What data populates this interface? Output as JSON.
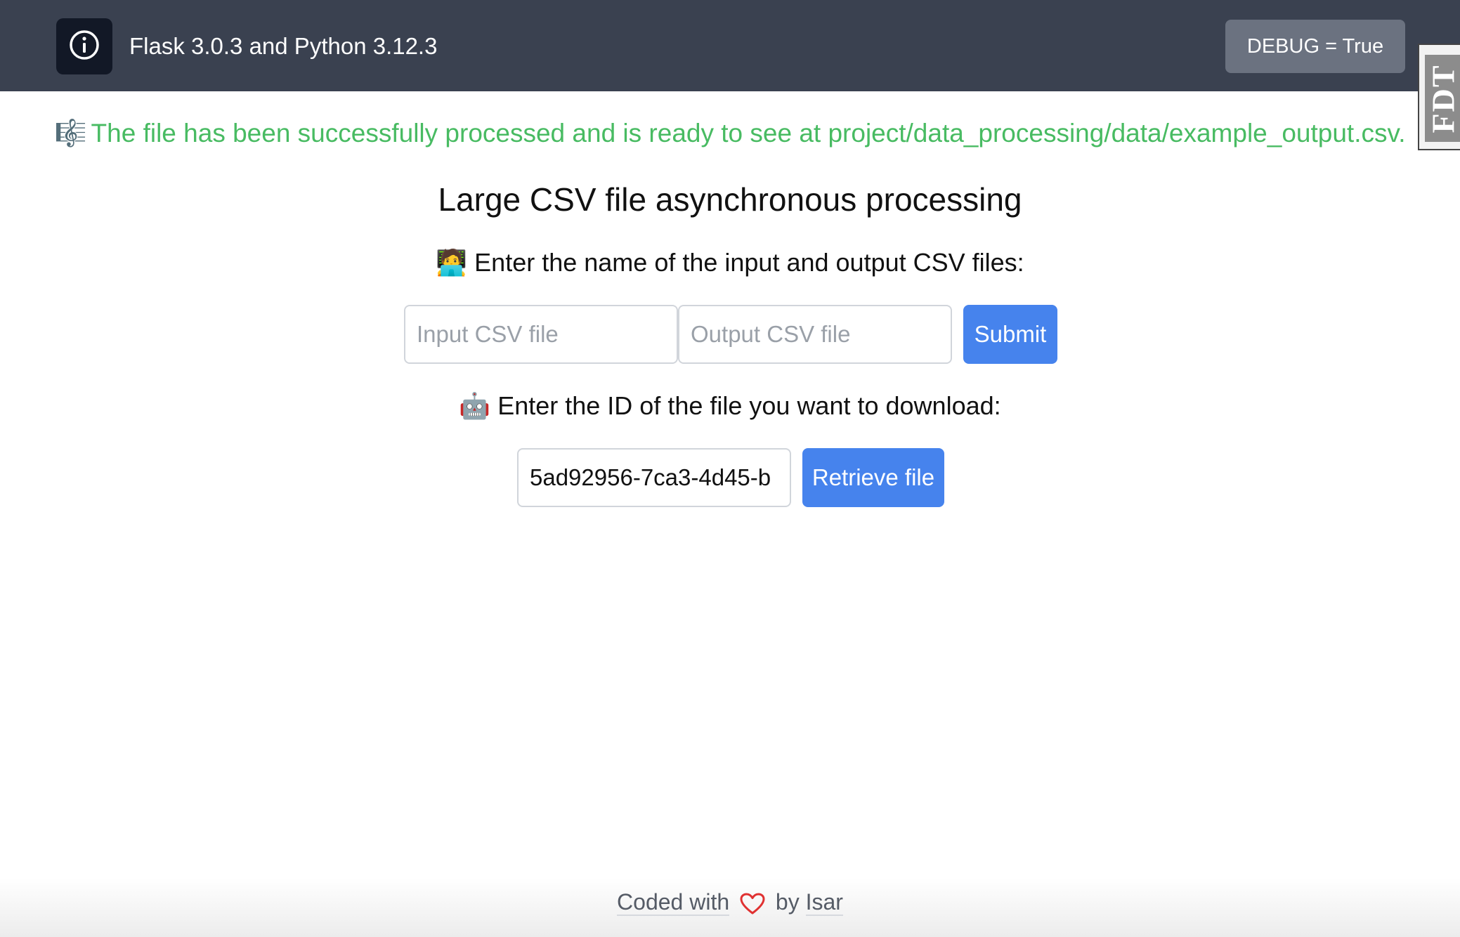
{
  "header": {
    "icon": "info-icon",
    "title": "Flask 3.0.3 and Python 3.12.3",
    "debug_label": "DEBUG = True",
    "side_tab_label": "FDT"
  },
  "flash": {
    "emoji": "🎼",
    "message": "The file has been successfully processed and is ready to see at project/data_processing/data/example_output.csv."
  },
  "main": {
    "title": "Large CSV file asynchronous processing",
    "process_prompt_emoji": "🧑‍💻",
    "process_prompt": "Enter the name of the input and output CSV files:",
    "input_placeholder": "Input CSV file",
    "output_placeholder": "Output CSV file",
    "submit_label": "Submit",
    "download_prompt_emoji": "🤖",
    "download_prompt": "Enter the ID of the file you want to download:",
    "file_id_value": "5ad92956-7ca3-4d45-b",
    "retrieve_label": "Retrieve file"
  },
  "footer": {
    "coded_with": "Coded with",
    "heart_icon": "heart-icon",
    "by": "by",
    "author": "Isar"
  },
  "colors": {
    "navbar": "#3a4150",
    "success": "#48bb62",
    "primary_button": "#4683ed",
    "debug_button": "#6b7280"
  }
}
